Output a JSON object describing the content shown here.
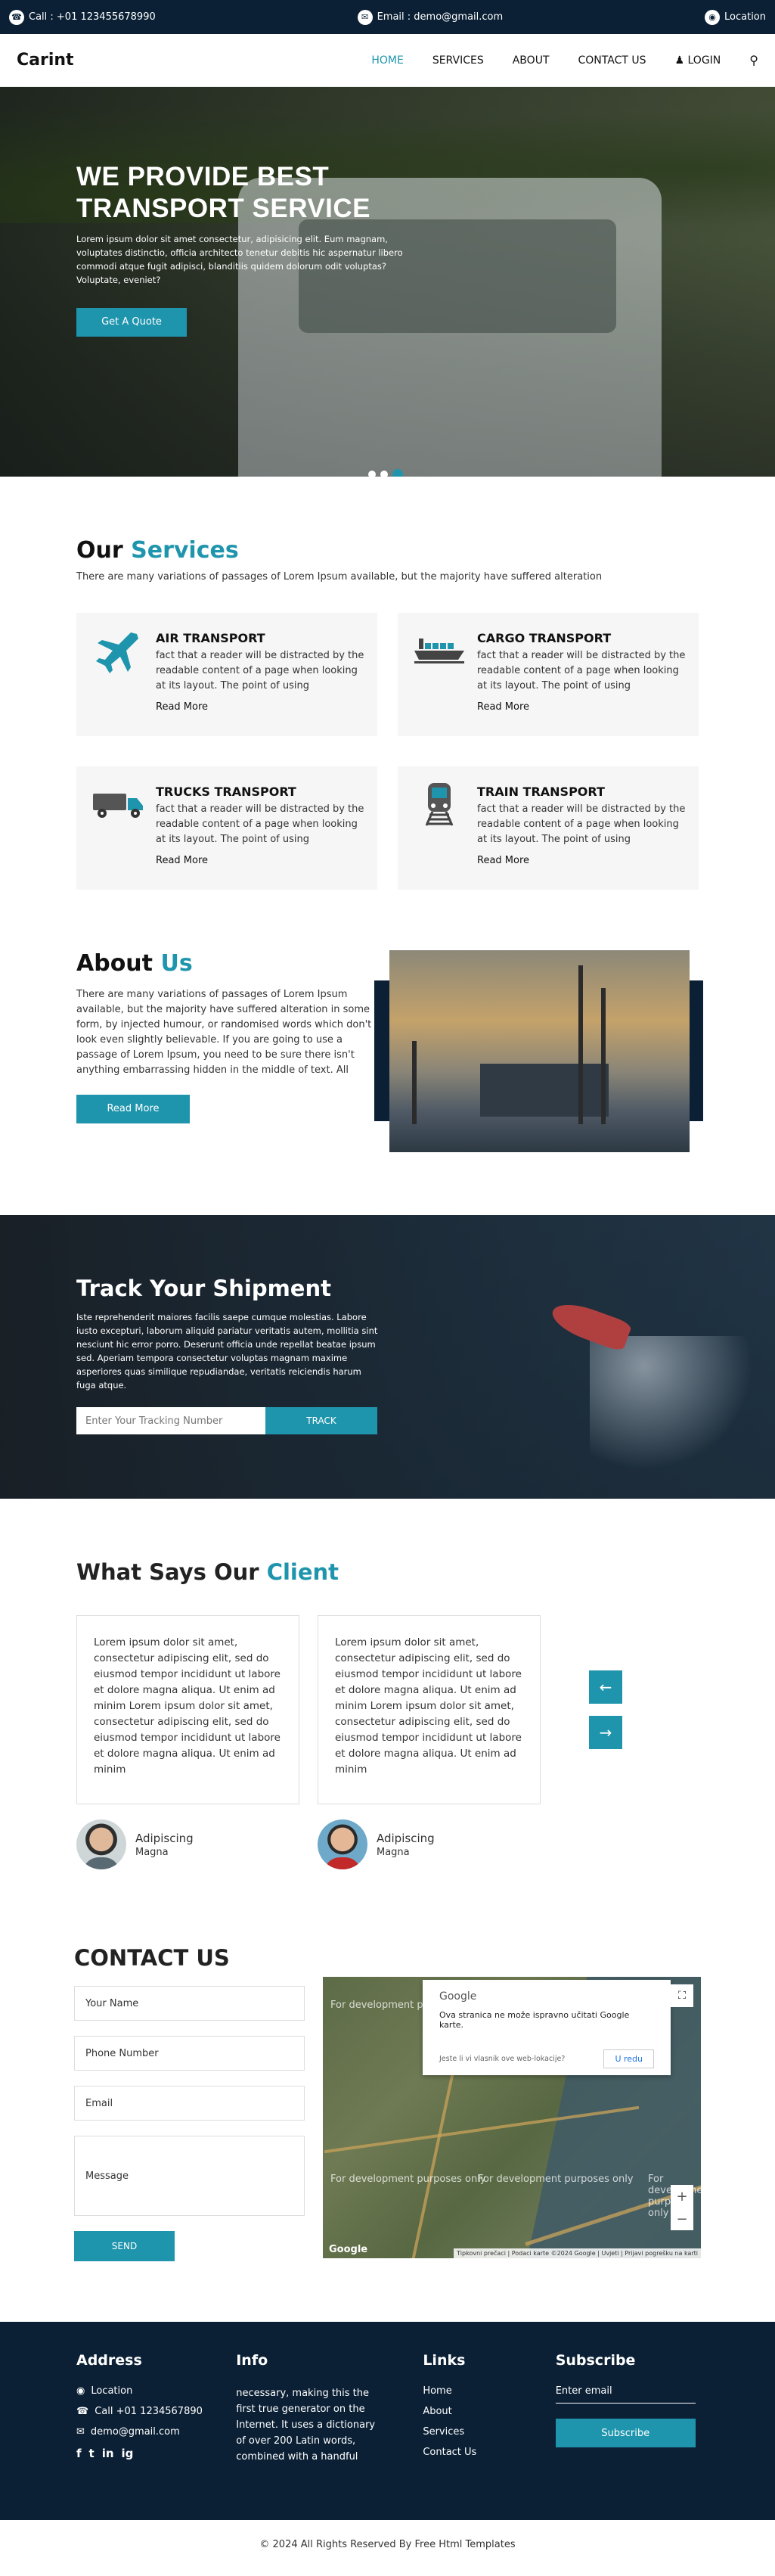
{
  "topbar": {
    "phone": "Call : +01 123455678990",
    "email": "Email : demo@gmail.com",
    "location": "Location"
  },
  "nav": {
    "brand": "Carint",
    "items": [
      "HOME",
      "SERVICES",
      "ABOUT",
      "CONTACT US"
    ],
    "login": "LOGIN"
  },
  "hero": {
    "title_line1": "WE PROVIDE BEST",
    "title_line2": "TRANSPORT SERVICE",
    "text": "Lorem ipsum dolor sit amet consectetur, adipisicing elit. Eum magnam, voluptates distinctio, officia architecto tenetur debitis hic aspernatur libero commodi atque fugit adipisci, blanditiis quidem dolorum odit voluptas? Voluptate, eveniet?",
    "button": "Get A Quote",
    "slide_count": 3,
    "active_slide": 3
  },
  "services": {
    "title_plain": "Our ",
    "title_accent": "Services",
    "subtitle": "There are many variations of passages of Lorem Ipsum available, but the majority have suffered alteration",
    "items": [
      {
        "title": "AIR TRANSPORT",
        "text": "fact that a reader will be distracted by the readable content of a page when looking at its layout. The point of using",
        "link": "Read More",
        "icon": "airplane-icon"
      },
      {
        "title": "CARGO TRANSPORT",
        "text": "fact that a reader will be distracted by the readable content of a page when looking at its layout. The point of using",
        "link": "Read More",
        "icon": "cargo-ship-icon"
      },
      {
        "title": "TRUCKS TRANSPORT",
        "text": "fact that a reader will be distracted by the readable content of a page when looking at its layout. The point of using",
        "link": "Read More",
        "icon": "truck-icon"
      },
      {
        "title": "TRAIN TRANSPORT",
        "text": "fact that a reader will be distracted by the readable content of a page when looking at its layout. The point of using",
        "link": "Read More",
        "icon": "train-icon"
      }
    ]
  },
  "about": {
    "title_plain": "About ",
    "title_accent": "Us",
    "text": "There are many variations of passages of Lorem Ipsum available, but the majority have suffered alteration in some form, by injected humour, or randomised words which don't look even slightly believable. If you are going to use a passage of Lorem Ipsum, you need to be sure there isn't anything embarrassing hidden in the middle of text. All",
    "button": "Read More"
  },
  "track": {
    "title": "Track Your Shipment",
    "text": "Iste reprehenderit maiores facilis saepe cumque molestias. Labore iusto excepturi, laborum aliquid pariatur veritatis autem, mollitia sint nesciunt hic error porro. Deserunt officia unde repellat beatae ipsum sed. Aperiam tempora consectetur voluptas magnam maxime asperiores quas similique repudiandae, veritatis reiciendis harum fuga atque.",
    "placeholder": "Enter Your Tracking Number",
    "button": "TRACK"
  },
  "client": {
    "title_plain": "What Says Our ",
    "title_accent": "Client",
    "testimonials": [
      {
        "text": "Lorem ipsum dolor sit amet, consectetur adipiscing elit, sed do eiusmod tempor incididunt ut labore et dolore magna aliqua. Ut enim ad minim Lorem ipsum dolor sit amet, consectetur adipiscing elit, sed do eiusmod tempor incididunt ut labore et dolore magna aliqua. Ut enim ad minim",
        "name": "Adipiscing",
        "role": "Magna"
      },
      {
        "text": "Lorem ipsum dolor sit amet, consectetur adipiscing elit, sed do eiusmod tempor incididunt ut labore et dolore magna aliqua. Ut enim ad minim Lorem ipsum dolor sit amet, consectetur adipiscing elit, sed do eiusmod tempor incididunt ut labore et dolore magna aliqua. Ut enim ad minim",
        "name": "Adipiscing",
        "role": "Magna"
      }
    ],
    "prev": "←",
    "next": "→"
  },
  "contact": {
    "title": "CONTACT US",
    "fields": {
      "name": "Your Name",
      "phone": "Phone Number",
      "email": "Email",
      "message": "Message"
    },
    "button": "SEND",
    "map": {
      "popup_logo": "Google",
      "popup_message": "Ova stranica ne može ispravno učitati Google karte.",
      "popup_question": "Jeste li vi vlasnik ove web-lokacije?",
      "popup_ok": "U redu",
      "dev_text": "For development purposes only",
      "attribution": "Tipkovni prečaci | Podaci karte ©2024 Google | Uvjeti | Prijavi pogrešku na karti",
      "google_logo": "Google"
    }
  },
  "footer": {
    "address_title": "Address",
    "location": "Location",
    "phone": "Call +01 1234567890",
    "email": "demo@gmail.com",
    "social": [
      "f",
      "t",
      "in",
      "ig"
    ],
    "info_title": "Info",
    "info_text": "necessary, making this the first true generator on the Internet. It uses a dictionary of over 200 Latin words, combined with a handful",
    "links_title": "Links",
    "links": [
      "Home",
      "About",
      "Services",
      "Contact Us"
    ],
    "subscribe_title": "Subscribe",
    "subscribe_placeholder": "Enter email",
    "subscribe_button": "Subscribe"
  },
  "copyright": "© 2024 All Rights Reserved By Free Html Templates",
  "colors": {
    "accent": "#1f95ad",
    "dark": "#0b2035"
  }
}
